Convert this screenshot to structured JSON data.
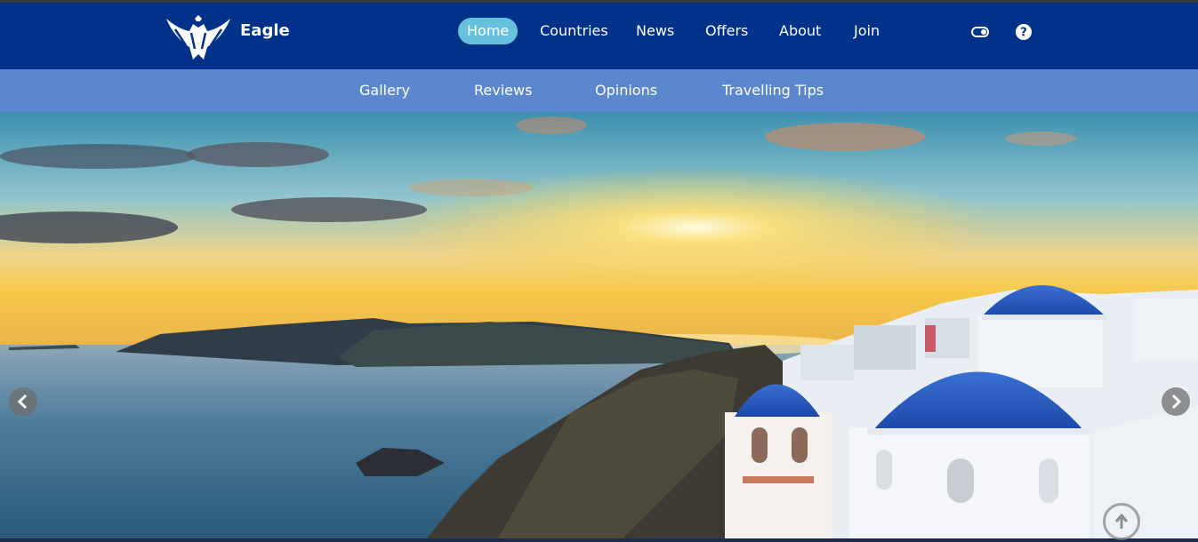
{
  "brand": {
    "name": "Eagle",
    "logo_icon": "eagle-logo-icon"
  },
  "nav": {
    "items": [
      {
        "label": "Home",
        "active": true
      },
      {
        "label": "Countries",
        "active": false
      },
      {
        "label": "News",
        "active": false
      },
      {
        "label": "Offers",
        "active": false
      },
      {
        "label": "About",
        "active": false
      },
      {
        "label": "Join",
        "active": false
      }
    ],
    "icons": [
      "theme-toggle-icon",
      "help-icon"
    ]
  },
  "subnav": {
    "items": [
      {
        "label": "Gallery"
      },
      {
        "label": "Reviews"
      },
      {
        "label": "Opinions"
      },
      {
        "label": "Travelling Tips"
      }
    ]
  },
  "hero": {
    "description_icon": "santorini-sunset-image",
    "controls": [
      "chevron-left-icon",
      "chevron-right-icon",
      "scroll-to-top-icon"
    ]
  },
  "colors": {
    "navbar": "#00328a",
    "subnav": "#5b87cf",
    "active_pill": "#66c2dc"
  }
}
